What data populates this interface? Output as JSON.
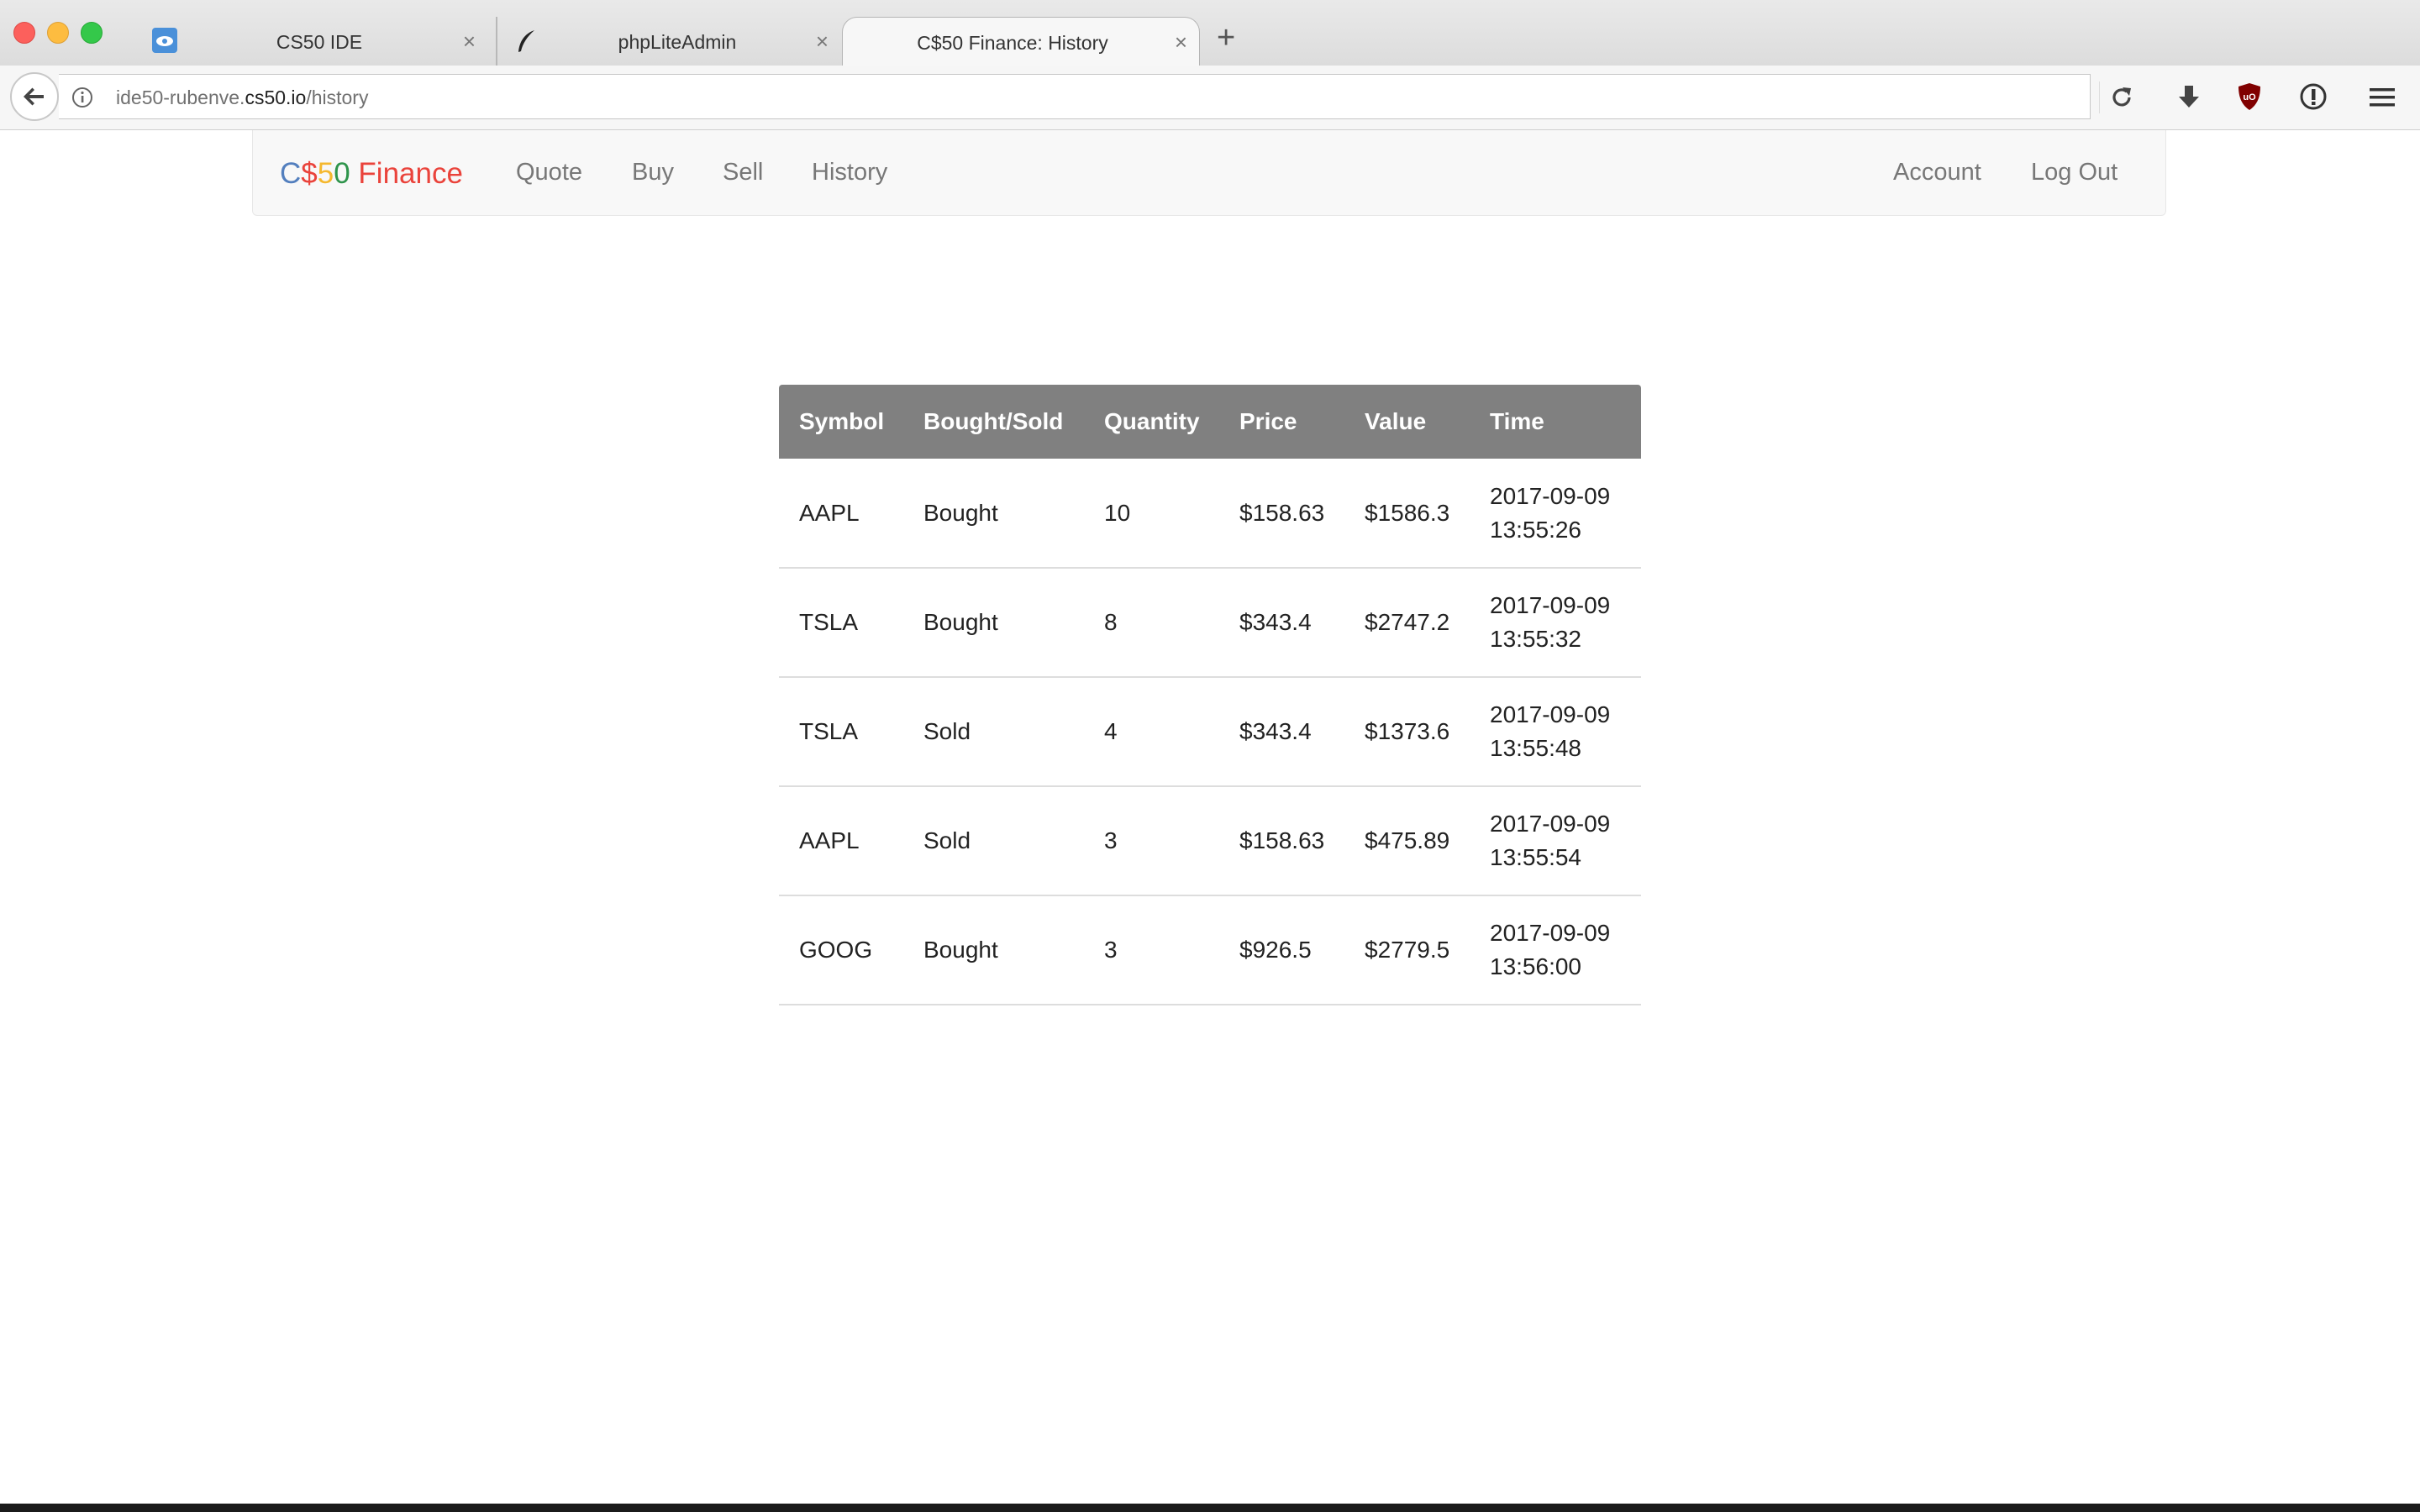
{
  "browser": {
    "tabs": [
      {
        "title": "CS50 IDE",
        "icon": "cloud9-icon",
        "active": false
      },
      {
        "title": "phpLiteAdmin",
        "icon": "feather-icon",
        "active": false
      },
      {
        "title": "C$50 Finance: History",
        "icon": "",
        "active": true
      }
    ],
    "url": {
      "prefix": "ide50-rubenve.",
      "host": "cs50.io",
      "path": "/history"
    },
    "toolbar_icons": [
      "back-icon",
      "info-icon",
      "reload-icon",
      "download-icon",
      "ublock-icon",
      "1password-icon",
      "hamburger-menu-icon"
    ],
    "colors": {
      "close": "#fc605c",
      "minimize": "#fdbc40",
      "zoom": "#34c84a"
    }
  },
  "site": {
    "brand": {
      "c": "C",
      "dollar": "$",
      "five": "5",
      "zero": "0",
      "finance": " Finance"
    },
    "brand_colors": {
      "blue": "#537fbe",
      "red": "#ea433b",
      "yellow": "#f5b82e",
      "green": "#2e944b"
    },
    "nav": {
      "quote": "Quote",
      "buy": "Buy",
      "sell": "Sell",
      "history": "History",
      "account": "Account",
      "logout": "Log Out"
    }
  },
  "history": {
    "headers": [
      "Symbol",
      "Bought/Sold",
      "Quantity",
      "Price",
      "Value",
      "Time"
    ],
    "header_color": "#808080",
    "rows": [
      {
        "symbol": "AAPL",
        "action": "Bought",
        "quantity": "10",
        "price": "$158.63",
        "value": "$1586.3",
        "time": "2017-09-09\n13:55:26"
      },
      {
        "symbol": "TSLA",
        "action": "Bought",
        "quantity": "8",
        "price": "$343.4",
        "value": "$2747.2",
        "time": "2017-09-09\n13:55:32"
      },
      {
        "symbol": "TSLA",
        "action": "Sold",
        "quantity": "4",
        "price": "$343.4",
        "value": "$1373.6",
        "time": "2017-09-09\n13:55:48"
      },
      {
        "symbol": "AAPL",
        "action": "Sold",
        "quantity": "3",
        "price": "$158.63",
        "value": "$475.89",
        "time": "2017-09-09\n13:55:54"
      },
      {
        "symbol": "GOOG",
        "action": "Bought",
        "quantity": "3",
        "price": "$926.5",
        "value": "$2779.5",
        "time": "2017-09-09\n13:56:00"
      }
    ]
  }
}
